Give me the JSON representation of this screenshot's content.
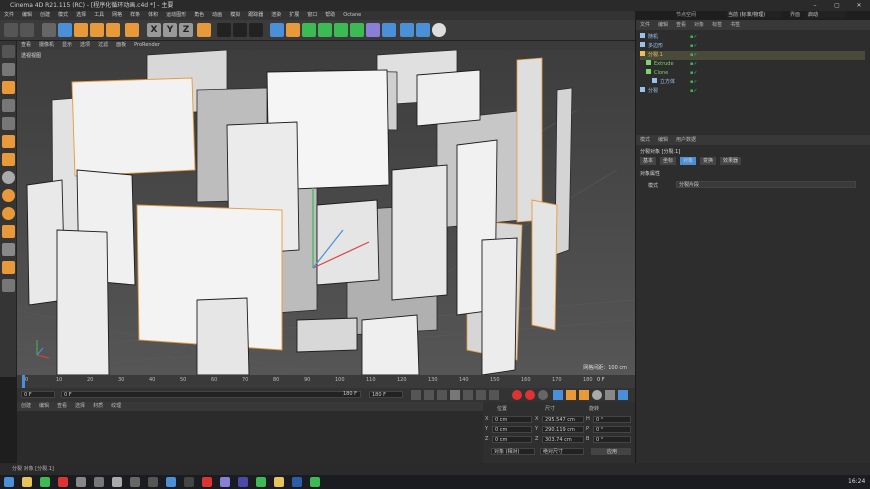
{
  "window": {
    "title": "Cinema 4D R21.115 (RC) - [程序化循环动画.c4d *] - 主要"
  },
  "menu": [
    "文件",
    "编辑",
    "创建",
    "模式",
    "选择",
    "工具",
    "网格",
    "样条",
    "体积",
    "运动图形",
    "角色",
    "动画",
    "模拟",
    "跟踪器",
    "渲染",
    "扩展",
    "窗口",
    "帮助",
    "Octane"
  ],
  "layout": {
    "label": "节点空间",
    "value": "当前 (标准/物理)",
    "interface": "界面",
    "interface_value": "启动"
  },
  "viewport": {
    "menu": [
      "查看",
      "摄像机",
      "显示",
      "选项",
      "过滤",
      "面板",
      "ProRender"
    ],
    "label": "透视视图",
    "grid": "网格间距：100 cm"
  },
  "timeline": {
    "ticks": [
      "0",
      "10",
      "20",
      "30",
      "40",
      "50",
      "60",
      "70",
      "80",
      "90",
      "100",
      "110",
      "120",
      "130",
      "140",
      "150",
      "160",
      "170",
      "180"
    ],
    "frame_indicator": "0 F",
    "start": "0 F",
    "current": "0 F",
    "end": "180 F",
    "end2": "180 F"
  },
  "material": {
    "tabs": [
      "创建",
      "编辑",
      "查看",
      "选择",
      "材质",
      "纹理"
    ]
  },
  "coords": {
    "headers": [
      "位置",
      "尺寸",
      "旋转"
    ],
    "rows": [
      {
        "axis": "X",
        "pos": "0 cm",
        "sizeaxis": "X",
        "size": "295.547 cm",
        "rotaxis": "H",
        "rot": "0 °"
      },
      {
        "axis": "Y",
        "pos": "0 cm",
        "sizeaxis": "Y",
        "size": "290.119 cm",
        "rotaxis": "P",
        "rot": "0 °"
      },
      {
        "axis": "Z",
        "pos": "0 cm",
        "sizeaxis": "Z",
        "size": "303.74 cm",
        "rotaxis": "B",
        "rot": "0 °"
      }
    ],
    "mode1": "对象 (相对)",
    "mode2": "绝对尺寸",
    "apply": "应用"
  },
  "objects": {
    "tabs": [
      "文件",
      "编辑",
      "查看",
      "对象",
      "标签",
      "书签"
    ],
    "items": [
      {
        "name": "随机",
        "indent": 0,
        "color": "#9ac2e8"
      },
      {
        "name": "多边形",
        "indent": 0,
        "color": "#9ac2e8"
      },
      {
        "name": "分裂.1",
        "indent": 0,
        "color": "#e8c35a"
      },
      {
        "name": "Extrude",
        "indent": 1,
        "color": "#7fd36b"
      },
      {
        "name": "Clone",
        "indent": 1,
        "color": "#7fd36b"
      },
      {
        "name": "立方体",
        "indent": 2,
        "color": "#9ac2e8"
      },
      {
        "name": "分裂",
        "indent": 0,
        "color": "#9ac2e8"
      }
    ]
  },
  "attributes": {
    "tabs": [
      "模式",
      "编辑",
      "用户数据"
    ],
    "object_label": "分裂对象 [分裂.1]",
    "subtabs": [
      "基本",
      "坐标",
      "对象",
      "变换",
      "效果器"
    ],
    "section": "对象属性",
    "mode_label": "模式",
    "mode_value": "分裂片段"
  },
  "status": {
    "text": "分裂 对象 [分裂.1]"
  },
  "taskbar": {
    "time": "16:24"
  },
  "colors": {
    "accent_orange": "#e89a3a",
    "accent_blue": "#4a90d9",
    "selected_row": "#4a4a3a"
  }
}
